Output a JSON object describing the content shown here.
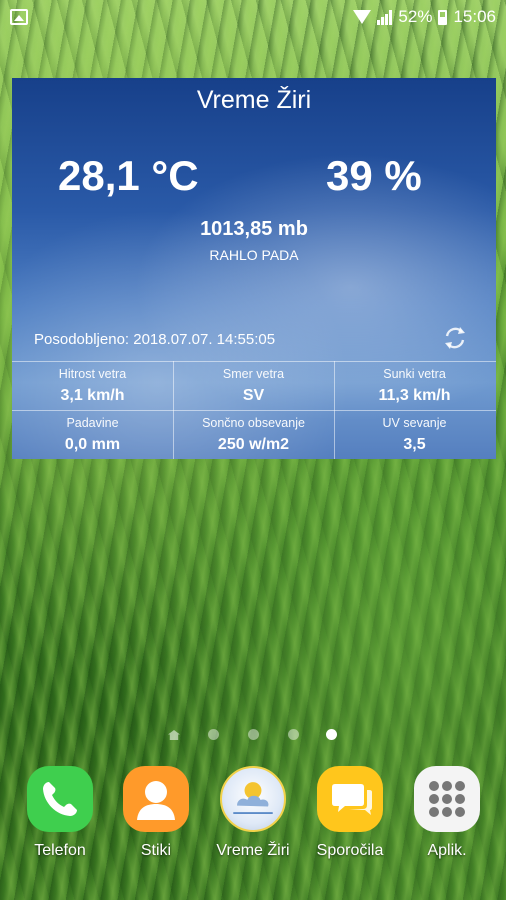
{
  "status_bar": {
    "battery": "52%",
    "time": "15:06"
  },
  "widget": {
    "title": "Vreme Žiri",
    "temperature": "28,1 °C",
    "humidity": "39 %",
    "pressure": "1013,85 mb",
    "pressure_trend": "RAHLO PADA",
    "updated": "Posodobljeno: 2018.07.07. 14:55:05",
    "stats": [
      {
        "label": "Hitrost vetra",
        "value": "3,1 km/h"
      },
      {
        "label": "Smer vetra",
        "value": "SV"
      },
      {
        "label": "Sunki vetra",
        "value": "11,3 km/h"
      },
      {
        "label": "Padavine",
        "value": "0,0 mm"
      },
      {
        "label": "Sončno obsevanje",
        "value": "250 w/m2"
      },
      {
        "label": "UV sevanje",
        "value": "3,5"
      }
    ]
  },
  "home": {
    "page_count": 5,
    "active_page": 5
  },
  "dock": [
    {
      "label": "Telefon",
      "icon": "phone-icon"
    },
    {
      "label": "Stiki",
      "icon": "contact-icon"
    },
    {
      "label": "Vreme Žiri",
      "icon": "weather-app-icon"
    },
    {
      "label": "Sporočila",
      "icon": "messages-icon"
    },
    {
      "label": "Aplik.",
      "icon": "apps-grid-icon"
    }
  ],
  "colors": {
    "widget_top": "#17408a",
    "widget_bottom": "#6f9ad0",
    "phone": "#3fcf4e",
    "contacts": "#ff9a2a",
    "messages": "#ffc61c"
  }
}
